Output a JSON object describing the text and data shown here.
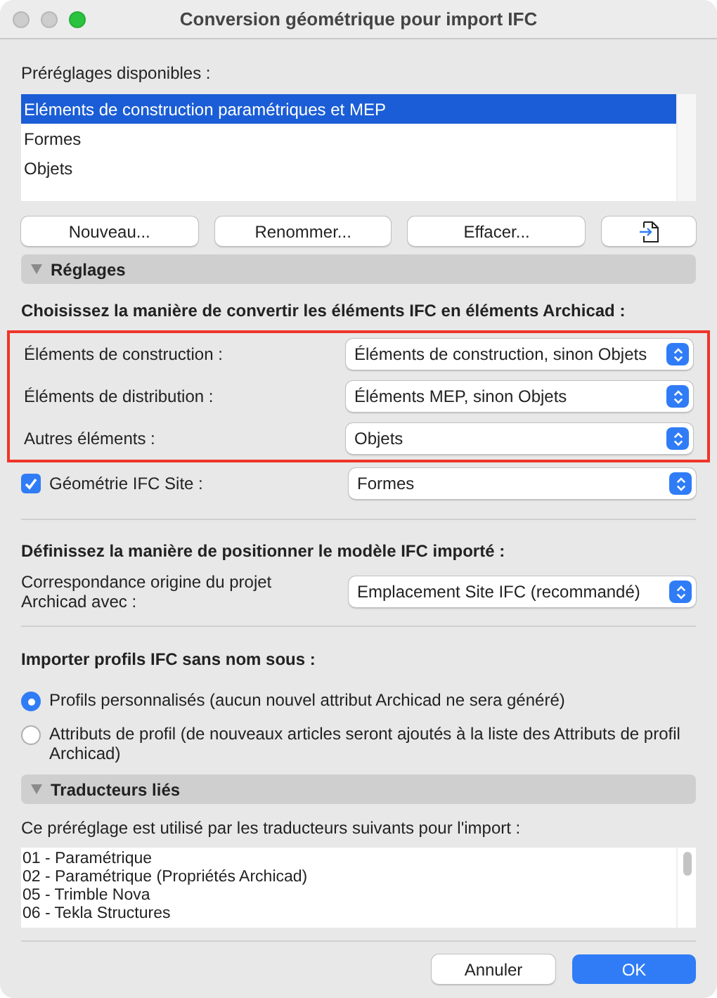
{
  "window": {
    "title": "Conversion géométrique pour import IFC"
  },
  "presets": {
    "label": "Préréglages disponibles :",
    "items": [
      {
        "label": "Eléments de construction paramétriques et MEP",
        "selected": true
      },
      {
        "label": "Formes",
        "selected": false
      },
      {
        "label": "Objets",
        "selected": false
      }
    ]
  },
  "preset_buttons": [
    "Nouveau...",
    "Renommer...",
    "Effacer..."
  ],
  "settings": {
    "title": "Réglages",
    "expanded": true,
    "conversion_heading": "Choisissez la manière de convertir les éléments IFC en éléments Archicad :",
    "conversion_highlighted": true,
    "conversion_rows": [
      {
        "label": "Éléments de construction :",
        "value": "Éléments de construction, sinon Objets"
      },
      {
        "label": "Éléments de distribution :",
        "value": "Éléments MEP, sinon Objets"
      },
      {
        "label": "Autres éléments :",
        "value": "Objets"
      }
    ],
    "site_geometry": {
      "label": "Géométrie IFC Site :",
      "checked": true,
      "value": "Formes"
    },
    "position_heading": "Définissez la manière de positionner le modèle IFC importé :",
    "origin": {
      "label": "Correspondance origine du projet Archicad avec :",
      "value": "Emplacement Site IFC (recommandé)"
    },
    "profiles_heading": "Importer profils IFC sans nom sous :",
    "profile_options": [
      {
        "label": "Profils personnalisés (aucun nouvel attribut Archicad ne sera généré)",
        "selected": true
      },
      {
        "label": "Attributs de profil (de nouveaux articles seront ajoutés à la liste des Attributs de profil Archicad)",
        "selected": false
      }
    ]
  },
  "translators": {
    "title": "Traducteurs liés",
    "expanded": true,
    "label": "Ce préréglage est utilisé par les traducteurs suivants pour l'import :",
    "items": [
      "01 - Paramétrique",
      "02 - Paramétrique (Propriétés Archicad)",
      "05 - Trimble Nova",
      "06 - Tekla Structures"
    ]
  },
  "footer_buttons": [
    {
      "label": "Annuler",
      "kind": "secondary"
    },
    {
      "label": "OK",
      "kind": "primary"
    }
  ]
}
